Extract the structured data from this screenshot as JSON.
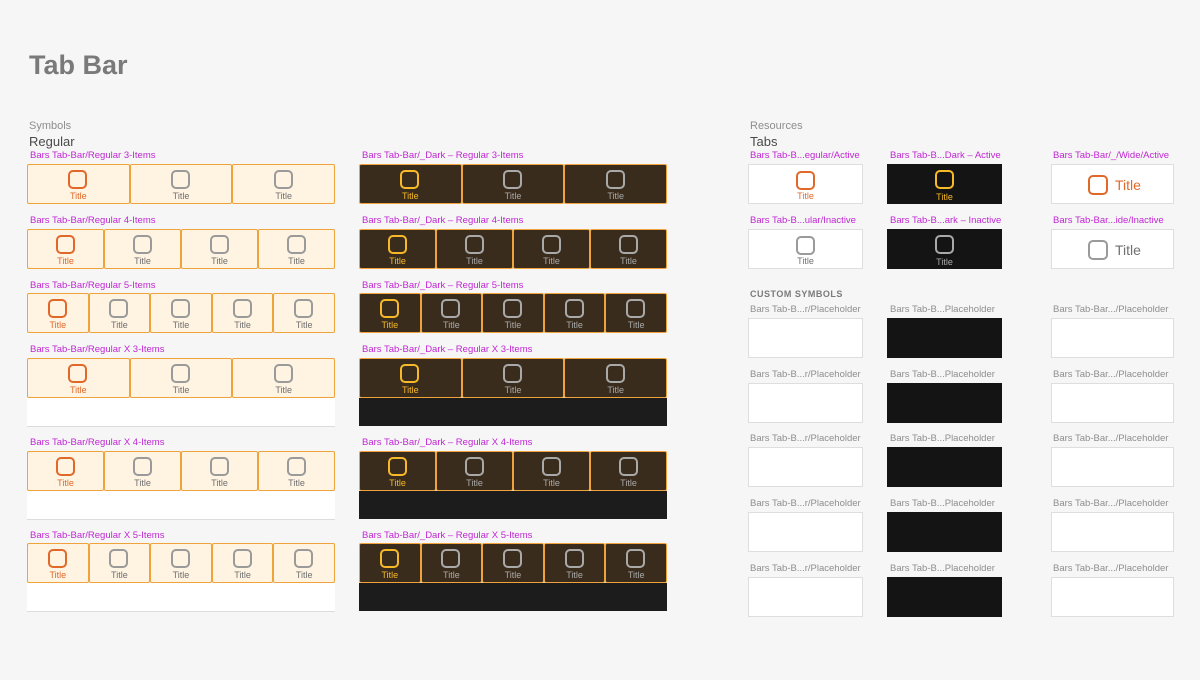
{
  "page_title": "Tab Bar",
  "symbols": {
    "section_label": "Symbols",
    "subsection": "Regular",
    "item_label": "Title",
    "light_bars": [
      {
        "label": "Bars Tab-Bar/Regular 3-Items",
        "items": 3
      },
      {
        "label": "Bars Tab-Bar/Regular 4-Items",
        "items": 4
      },
      {
        "label": "Bars Tab-Bar/Regular 5-Items",
        "items": 5
      },
      {
        "label": "Bars Tab-Bar/Regular X 3-Items",
        "items": 3
      },
      {
        "label": "Bars Tab-Bar/Regular X 4-Items",
        "items": 4
      },
      {
        "label": "Bars Tab-Bar/Regular X 5-Items",
        "items": 5
      }
    ],
    "dark_bars": [
      {
        "label": "Bars Tab-Bar/_Dark – Regular 3-Items",
        "items": 3
      },
      {
        "label": "Bars Tab-Bar/_Dark – Regular 4-Items",
        "items": 4
      },
      {
        "label": "Bars Tab-Bar/_Dark – Regular 5-Items",
        "items": 5
      },
      {
        "label": "Bars Tab-Bar/_Dark – Regular X 3-Items",
        "items": 3
      },
      {
        "label": "Bars Tab-Bar/_Dark – Regular X 4-Items",
        "items": 4
      },
      {
        "label": "Bars Tab-Bar/_Dark – Regular X 5-Items",
        "items": 5
      }
    ]
  },
  "resources": {
    "section_label": "Resources",
    "subsection": "Tabs",
    "tab_label": "Title",
    "tabs": [
      {
        "label": "Bars Tab-B...egular/Active"
      },
      {
        "label": "Bars Tab-B...Dark – Active"
      },
      {
        "label": "Bars Tab-Bar/_/Wide/Active"
      },
      {
        "label": "Bars Tab-B...ular/Inactive"
      },
      {
        "label": "Bars Tab-B...ark – Inactive"
      },
      {
        "label": "Bars Tab-Bar...ide/Inactive"
      }
    ],
    "custom_symbols_heading": "CUSTOM SYMBOLS",
    "placeholders": [
      "Bars Tab-B...r/Placeholder",
      "Bars Tab-B...Placeholder",
      "Bars Tab-Bar.../Placeholder",
      "Bars Tab-B...r/Placeholder",
      "Bars Tab-B...Placeholder",
      "Bars Tab-Bar.../Placeholder",
      "Bars Tab-B...r/Placeholder",
      "Bars Tab-B...Placeholder",
      "Bars Tab-Bar.../Placeholder",
      "Bars Tab-B...r/Placeholder",
      "Bars Tab-B...Placeholder",
      "Bars Tab-Bar.../Placeholder",
      "Bars Tab-B...r/Placeholder",
      "Bars Tab-B...Placeholder",
      "Bars Tab-Bar.../Placeholder"
    ]
  },
  "colors": {
    "accent_light": "#e0692a",
    "accent_dark": "#f7b928",
    "symbol_label": "#c026d3",
    "bar_border": "#f0a33a"
  },
  "icons": {
    "tab_icon": "rounded-square-icon"
  }
}
